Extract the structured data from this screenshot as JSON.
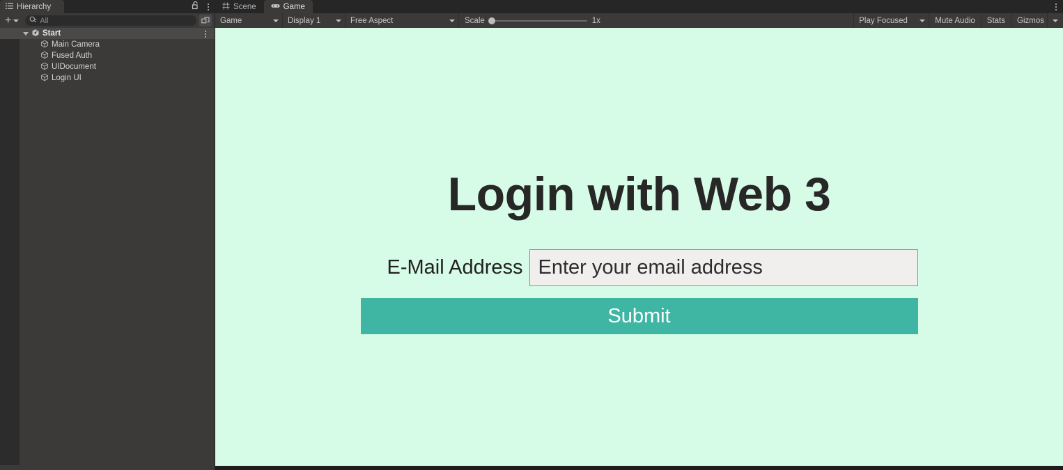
{
  "hierarchy_panel": {
    "tab": {
      "label": "Hierarchy",
      "icon": "hierarchy-list-icon"
    },
    "lock_icon": "lock-open-icon",
    "menu_icon": "kebab-menu-icon",
    "toolbar": {
      "add_label": "+",
      "add_dropdown_icon": "chevron-down-icon",
      "search": {
        "value": "",
        "placeholder": "All",
        "icon": "search-icon"
      },
      "selection_icon": "selection-window-icon"
    },
    "tree": [
      {
        "label": "Start",
        "type": "scene",
        "icon": "unity-scene-icon",
        "expanded": true,
        "selected": true,
        "depth": 0,
        "row_menu_icon": "kebab-menu-icon"
      },
      {
        "label": "Main Camera",
        "type": "gameobject",
        "icon": "gameobject-cube-icon",
        "depth": 1
      },
      {
        "label": "Fused Auth",
        "type": "gameobject",
        "icon": "gameobject-cube-icon",
        "depth": 1
      },
      {
        "label": "UIDocument",
        "type": "gameobject",
        "icon": "gameobject-cube-icon",
        "depth": 1
      },
      {
        "label": "Login UI",
        "type": "gameobject",
        "icon": "gameobject-cube-icon",
        "depth": 1
      }
    ]
  },
  "game_panel": {
    "tabs": [
      {
        "label": "Scene",
        "icon": "scene-grid-icon",
        "active": false
      },
      {
        "label": "Game",
        "icon": "gamepad-icon",
        "active": true
      }
    ],
    "menu_icon": "kebab-menu-icon",
    "toolbar": {
      "view_type": {
        "value": "Game",
        "caret_icon": "chevron-down-icon"
      },
      "display": {
        "value": "Display 1",
        "caret_icon": "chevron-down-icon"
      },
      "aspect": {
        "value": "Free Aspect",
        "caret_icon": "chevron-down-icon"
      },
      "scale": {
        "label": "Scale",
        "value": "1x",
        "knob_position_pct": 0
      },
      "play_mode": {
        "value": "Play Focused",
        "caret_icon": "chevron-down-icon"
      },
      "mute_audio": "Mute Audio",
      "stats": "Stats",
      "gizmos": "Gizmos",
      "gizmos_caret_icon": "chevron-down-icon"
    }
  },
  "game_content": {
    "title": "Login with Web 3",
    "email_label": "E-Mail Address",
    "email_value": "",
    "email_placeholder": "Enter your email address",
    "submit_label": "Submit",
    "colors": {
      "background": "#d6fbe6",
      "submit_button": "#3fb5a3",
      "input_background": "#f0efee",
      "input_border": "#8f8f8f",
      "title_text": "#272727"
    }
  }
}
